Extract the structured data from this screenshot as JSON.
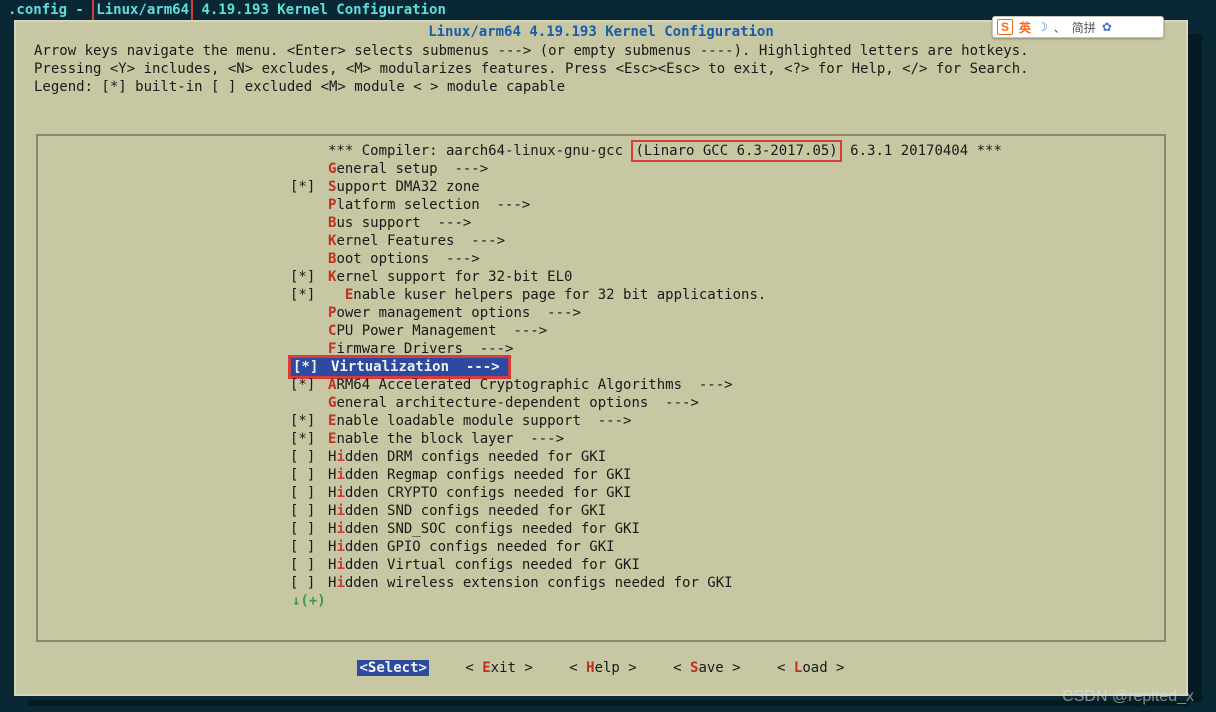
{
  "title": {
    "prefix": ".config - ",
    "highlight": "Linux/arm64",
    "suffix": " 4.19.193 Kernel Configuration"
  },
  "heading": "Linux/arm64 4.19.193 Kernel Configuration",
  "help_lines": [
    "Arrow keys navigate the menu.  <Enter> selects submenus ---> (or empty submenus ----).  Highlighted letters are hotkeys.",
    "Pressing <Y> includes, <N> excludes, <M> modularizes features.  Press <Esc><Esc> to exit, <?> for Help, </> for Search.",
    "Legend: [*] built-in  [ ] excluded  <M> module  < > module capable"
  ],
  "compiler": {
    "pre": "*** Compiler: aarch64-linux-gnu-gcc ",
    "boxed": "(Linaro GCC 6.3-2017.05)",
    "post": " 6.3.1 20170404 ***"
  },
  "items": {
    "i0": {
      "mark": "",
      "hk": "G",
      "label": "eneral setup  --->"
    },
    "i1": {
      "mark": "[*] ",
      "hk": "S",
      "label": "upport DMA32 zone"
    },
    "i2": {
      "mark": "",
      "hk": "P",
      "label": "latform selection  --->"
    },
    "i3": {
      "mark": "",
      "hk": "B",
      "label": "us support  --->"
    },
    "i4": {
      "mark": "",
      "hk": "K",
      "label": "ernel Features  --->"
    },
    "i5": {
      "mark": "",
      "hk": "B",
      "label": "oot options  --->"
    },
    "i6": {
      "mark": "[*] ",
      "hk": "K",
      "label": "ernel support for 32-bit EL0"
    },
    "i7": {
      "mark": "[*] ",
      "pre": "  ",
      "hk": "E",
      "label": "nable kuser helpers page for 32 bit applications."
    },
    "i8": {
      "mark": "",
      "hk": "P",
      "label": "ower management options  --->"
    },
    "i9": {
      "mark": "",
      "hk": "C",
      "label": "PU Power Management  --->"
    },
    "i10": {
      "mark": "",
      "hk": "F",
      "label": "irmware Drivers  --->"
    },
    "i11": {
      "mark": "[*] ",
      "hk": "V",
      "label": "irtualization  ---> "
    },
    "i12": {
      "mark": "[*] ",
      "hk": "A",
      "label": "RM64 Accelerated Cryptographic Algorithms  --->"
    },
    "i13": {
      "mark": "",
      "hk": "G",
      "label": "eneral architecture-dependent options  --->"
    },
    "i14": {
      "mark": "[*] ",
      "hk": "E",
      "label": "nable loadable module support  --->"
    },
    "i15": {
      "mark": "[*] ",
      "hk": "E",
      "label": "nable the block layer  --->"
    },
    "i16": {
      "mark": "[ ] ",
      "pre": "H",
      "hk": "i",
      "label": "dden DRM configs needed for GKI"
    },
    "i17": {
      "mark": "[ ] ",
      "pre": "H",
      "hk": "i",
      "label": "dden Regmap configs needed for GKI"
    },
    "i18": {
      "mark": "[ ] ",
      "pre": "H",
      "hk": "i",
      "label": "dden CRYPTO configs needed for GKI"
    },
    "i19": {
      "mark": "[ ] ",
      "pre": "H",
      "hk": "i",
      "label": "dden SND configs needed for GKI"
    },
    "i20": {
      "mark": "[ ] ",
      "pre": "H",
      "hk": "i",
      "label": "dden SND_SOC configs needed for GKI"
    },
    "i21": {
      "mark": "[ ] ",
      "pre": "H",
      "hk": "i",
      "label": "dden GPIO configs needed for GKI"
    },
    "i22": {
      "mark": "[ ] ",
      "pre": "H",
      "hk": "i",
      "label": "dden Virtual configs needed for GKI"
    },
    "i23": {
      "mark": "[ ] ",
      "pre": "H",
      "hk": "i",
      "label": "dden wireless extension configs needed for GKI"
    }
  },
  "more_indicator": "↓(+)",
  "buttons": {
    "select": {
      "open": "<",
      "hk": "S",
      "rest": "elect>",
      "close": ""
    },
    "exit": {
      "open": "< ",
      "hk": "E",
      "rest": "xit >",
      "close": ""
    },
    "help": {
      "open": "< ",
      "hk": "H",
      "rest": "elp >",
      "close": ""
    },
    "save": {
      "open": "< ",
      "hk": "S",
      "rest": "ave >",
      "close": ""
    },
    "load": {
      "open": "< ",
      "hk": "L",
      "rest": "oad >",
      "close": ""
    }
  },
  "ime": {
    "logo": "S",
    "lang": "英",
    "moon": "☽",
    "sep": "、",
    "mode": "简拼",
    "gear": "✿"
  },
  "watermark": "CSDN @repited_x"
}
